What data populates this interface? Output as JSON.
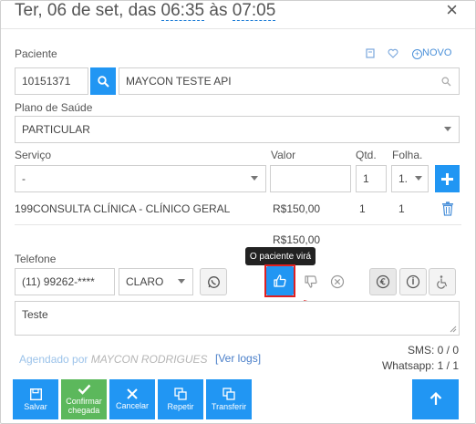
{
  "header": {
    "title_prefix": "Ter, 06 de set, das ",
    "start_time": "06:35",
    "title_middle": " às ",
    "end_time": "07:05",
    "close_label": "×"
  },
  "patient": {
    "label": "Paciente",
    "novo_label": "NOVO",
    "id_value": "10151371",
    "name_value": "MAYCON TESTE API"
  },
  "plan": {
    "label": "Plano de Saúde",
    "value": "PARTICULAR"
  },
  "service": {
    "service_label": "Serviço",
    "valor_label": "Valor",
    "qtd_label": "Qtd.",
    "folha_label": "Folha.",
    "service_value": "-",
    "qtd_value": "1",
    "folha_value": "1."
  },
  "service_row": {
    "code": "199",
    "name": "CONSULTA CLÍNICA - CLÍNICO GERAL",
    "valor": "R$150,00",
    "qtd": "1",
    "folha": "1"
  },
  "total": "R$150,00",
  "phone": {
    "label": "Telefone",
    "value": "(11) 99262-****",
    "carrier": "CLARO"
  },
  "tooltip": "O paciente virá",
  "notes": "Teste",
  "scheduled": {
    "prefix": "Agendado por",
    "user": "MAYCON RODRIGUES",
    "logs_link": "[Ver logs]"
  },
  "counters": {
    "sms": "SMS: 0 / 0",
    "whatsapp": "Whatsapp: 1 / 1"
  },
  "footer": {
    "save": "Salvar",
    "confirm_line1": "Confirmar",
    "confirm_line2": "chegada",
    "cancel": "Cancelar",
    "repeat": "Repetir",
    "transfer": "Transferir"
  },
  "colors": {
    "accent": "#2196f3",
    "confirm": "#5cb85c",
    "highlight": "#e02020"
  }
}
